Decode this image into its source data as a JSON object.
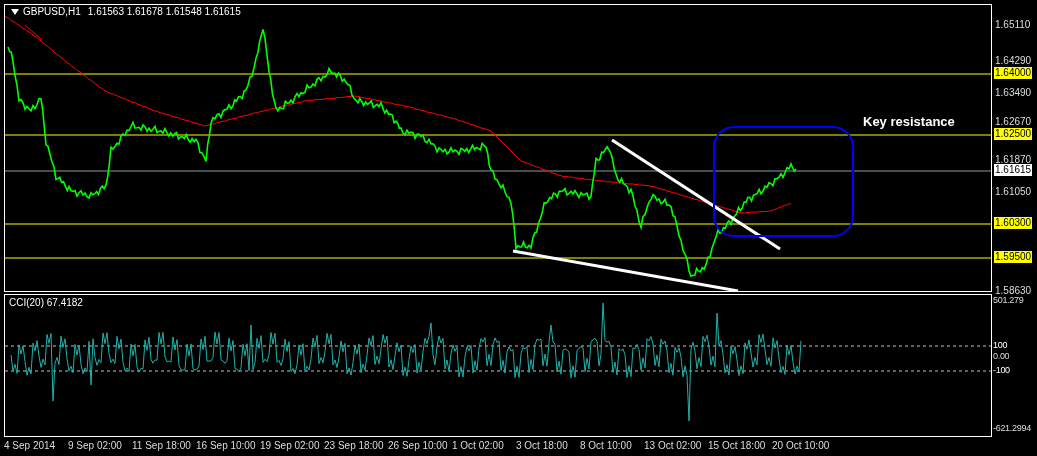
{
  "header": {
    "symbol": "GBPUSD,H1",
    "ohlc": "1.61563 1.61678 1.61548 1.61615"
  },
  "price_axis": [
    {
      "text": "1.65110",
      "kind": "tick"
    },
    {
      "text": "1.64290",
      "kind": "tick"
    },
    {
      "text": "1.64000",
      "kind": "level"
    },
    {
      "text": "1.63490",
      "kind": "tick"
    },
    {
      "text": "1.62670",
      "kind": "tick"
    },
    {
      "text": "1.62500",
      "kind": "level"
    },
    {
      "text": "1.61870",
      "kind": "tick"
    },
    {
      "text": "1.61615",
      "kind": "current"
    },
    {
      "text": "1.61050",
      "kind": "tick"
    },
    {
      "text": "1.60300",
      "kind": "level"
    },
    {
      "text": "1.59500",
      "kind": "level"
    },
    {
      "text": "1.58630",
      "kind": "tick"
    }
  ],
  "annotation": "Key resistance",
  "indicator": {
    "title": "CCI(20) 67.4182",
    "axis": [
      {
        "text": "501.279",
        "kind": "tick"
      },
      {
        "text": "100",
        "kind": "level"
      },
      {
        "text": "0.00",
        "kind": "tick"
      },
      {
        "text": "-100",
        "kind": "level"
      },
      {
        "text": "-621.2994",
        "kind": "tick"
      }
    ]
  },
  "time_axis": [
    "4 Sep 2014",
    "9 Sep 02:00",
    "11 Sep 18:00",
    "16 Sep 10:00",
    "19 Sep 02:00",
    "23 Sep 18:00",
    "26 Sep 10:00",
    "1 Oct 02:00",
    "3 Oct 18:00",
    "8 Oct 10:00",
    "13 Oct 02:00",
    "15 Oct 18:00",
    "20 Oct 10:00"
  ]
}
